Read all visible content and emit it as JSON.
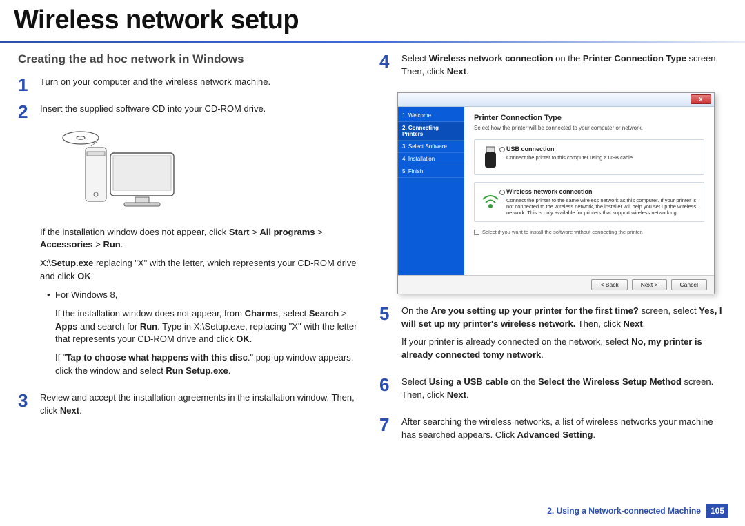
{
  "title": "Wireless network setup",
  "section_heading": "Creating the ad hoc network in Windows",
  "steps": {
    "1": {
      "num": "1",
      "text": "Turn on your computer and the wireless network machine."
    },
    "2": {
      "num": "2",
      "text_a": "Insert the supplied software CD into your CD-ROM drive.",
      "para1_a": "If the installation window does not appear, click ",
      "para1_b": "Start",
      "para1_c": " > ",
      "para1_d": "All programs",
      "para1_e": " > ",
      "para1_f": "Accessories",
      "para1_g": " > ",
      "para1_h": "Run",
      "para1_i": ".",
      "para2_a": "X:\\",
      "para2_b": "Setup.exe",
      "para2_c": " replacing \"X\" with the letter, which represents your CD-ROM drive and click ",
      "para2_d": "OK",
      "para2_e": ".",
      "bullet_label": "For Windows 8,",
      "bullet_p1_a": "If the installation window does not appear, from ",
      "bullet_p1_b": "Charms",
      "bullet_p1_c": ", select ",
      "bullet_p1_d": "Search",
      "bullet_p1_e": " > ",
      "bullet_p1_f": "Apps",
      "bullet_p1_g": " and search for ",
      "bullet_p1_h": "Run",
      "bullet_p1_i": ". Type in X:\\Setup.exe, replacing \"X\" with the letter that represents your CD-ROM drive and click ",
      "bullet_p1_j": "OK",
      "bullet_p1_k": ".",
      "bullet_p2_a": "If \"",
      "bullet_p2_b": "Tap to choose what happens with this disc",
      "bullet_p2_c": ".\" pop-up window appears, click the window and select ",
      "bullet_p2_d": "Run Setup.exe",
      "bullet_p2_e": "."
    },
    "3": {
      "num": "3",
      "text_a": "Review and accept the installation agreements in the installation window. Then, click ",
      "text_b": "Next",
      "text_c": "."
    },
    "4": {
      "num": "4",
      "text_a": "Select ",
      "text_b": "Wireless network connection",
      "text_c": " on the ",
      "text_d": "Printer Connection Type",
      "text_e": " screen. Then, click ",
      "text_f": "Next",
      "text_g": "."
    },
    "5": {
      "num": "5",
      "p1_a": "On the ",
      "p1_b": "Are you setting up your printer for the first time?",
      "p1_c": " screen, select ",
      "p1_d": "Yes, I will set up my printer's wireless network.",
      "p1_e": " Then, click ",
      "p1_f": "Next",
      "p1_g": ".",
      "p2_a": "If your printer is already connected on the network, select ",
      "p2_b": "No, my printer is already connected tomy network",
      "p2_c": "."
    },
    "6": {
      "num": "6",
      "text_a": "Select ",
      "text_b": "Using a USB cable",
      "text_c": " on the ",
      "text_d": "Select the Wireless Setup Method",
      "text_e": " screen. Then, click ",
      "text_f": "Next",
      "text_g": "."
    },
    "7": {
      "num": "7",
      "text_a": "After searching the wireless networks, a list of wireless networks your machine has searched appears. Click ",
      "text_b": "Advanced Setting",
      "text_c": "."
    }
  },
  "screenshot": {
    "close": "X",
    "side": {
      "s1": "1. Welcome",
      "s2": "2. Connecting Printers",
      "s3": "3. Select Software",
      "s4": "4. Installation",
      "s5": "5. Finish"
    },
    "heading": "Printer Connection Type",
    "subheading": "Select how the printer will be connected to your computer or network.",
    "opt1_title": "USB connection",
    "opt1_desc": "Connect the printer to this computer using a USB cable.",
    "opt2_title": "Wireless network connection",
    "opt2_desc": "Connect the printer to the same wireless network as this computer. If your printer is not connected to the wireless network, the installer will help you set up the wireless network. This is only available for printers that support wireless networking.",
    "checkbox": "Select if you want to install the software without connecting the printer.",
    "btn_back": "< Back",
    "btn_next": "Next >",
    "btn_cancel": "Cancel"
  },
  "footer": {
    "chapter": "2.  Using a Network-connected Machine",
    "page": "105"
  }
}
